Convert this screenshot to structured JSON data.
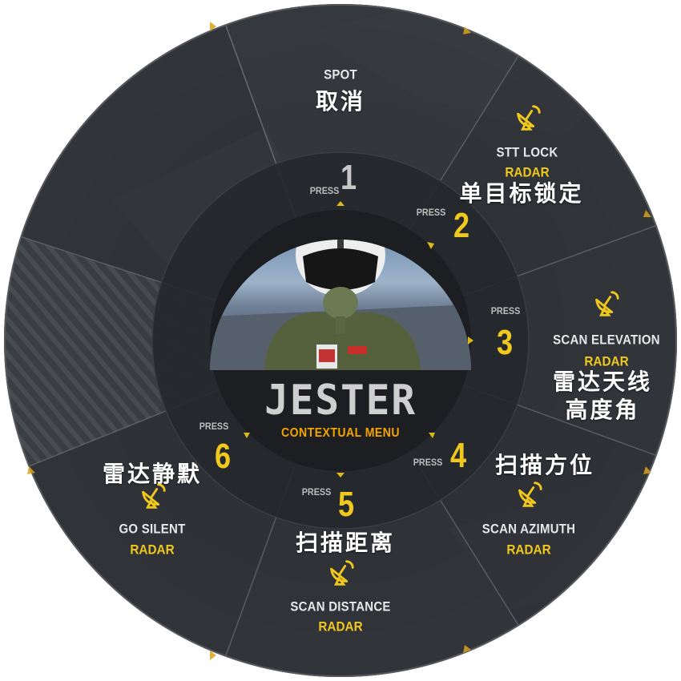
{
  "colors": {
    "accent_yellow": "#f0c91c",
    "subtitle_orange": "#f5a400",
    "option_active": "#f0c91c",
    "option_default": "#c8c8c8",
    "panel_dark": "#2b2e33",
    "inner_dark": "#1f2226"
  },
  "center": {
    "title": "JESTER",
    "subtitle": "CONTEXTUAL MENU",
    "portrait": "pilot-helmet-portrait"
  },
  "press_label": "PRESS",
  "options": [
    {
      "number": "1",
      "label": "SPOT",
      "category": "",
      "translation": "取消",
      "icon": ""
    },
    {
      "number": "2",
      "label": "STT LOCK",
      "category": "RADAR",
      "translation": "单目标锁定",
      "icon": "radar-dish-icon"
    },
    {
      "number": "3",
      "label": "SCAN ELEVATION",
      "category": "RADAR",
      "translation": "雷达天线\n高度角",
      "icon": "radar-dish-icon"
    },
    {
      "number": "4",
      "label": "SCAN AZIMUTH",
      "category": "RADAR",
      "translation": "扫描方位",
      "icon": "radar-dish-icon"
    },
    {
      "number": "5",
      "label": "SCAN DISTANCE",
      "category": "RADAR",
      "translation": "扫描距离",
      "icon": "radar-dish-icon"
    },
    {
      "number": "6",
      "label": "GO SILENT",
      "category": "RADAR",
      "translation": "雷达静默",
      "icon": "radar-dish-icon"
    }
  ]
}
